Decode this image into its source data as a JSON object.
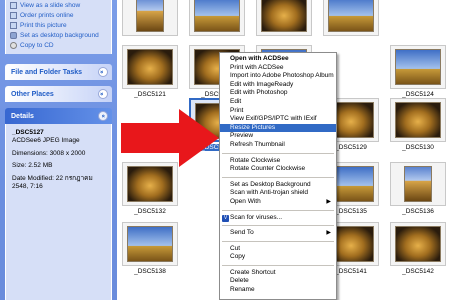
{
  "taskpane": {
    "picture_tasks": [
      {
        "label": "View as a slide show",
        "icon": "slideshow-icon"
      },
      {
        "label": "Order prints online",
        "icon": "prints-icon"
      },
      {
        "label": "Print this picture",
        "icon": "printer-icon"
      },
      {
        "label": "Set as desktop background",
        "icon": "desktop-icon"
      },
      {
        "label": "Copy to CD",
        "icon": "cd-icon"
      }
    ],
    "file_folder_tasks": "File and Folder Tasks",
    "other_places": "Other Places",
    "details": {
      "header": "Details",
      "filename": "_DSC5127",
      "type": "ACDSee6 JPEG Image",
      "dimensions": "Dimensions: 3008 x 2000",
      "size": "Size: 2.52 MB",
      "date_modified": "Date Modified: 22 กรกฎาคม 2548, 7:16"
    },
    "chevron": "«"
  },
  "thumbnails": [
    {
      "caption": "",
      "style": "portrait"
    },
    {
      "caption": "",
      "style": "sky"
    },
    {
      "caption": "",
      "style": "dark"
    },
    {
      "caption": "",
      "style": "sky"
    },
    {
      "caption": "_DSC5121",
      "style": "dark"
    },
    {
      "caption": "_DSC5122",
      "style": "dark"
    },
    {
      "caption": "_DSC5123",
      "style": "sky"
    },
    {
      "caption": "_DSC5124",
      "style": "sky"
    },
    {
      "caption": "_DSC5127",
      "style": "dark",
      "selected": true
    },
    {
      "caption": "_DSC5129",
      "style": "dark"
    },
    {
      "caption": "_DSC5130",
      "style": "dark"
    },
    {
      "caption": "_DSC5132",
      "style": "dark"
    },
    {
      "caption": "_DSC5135",
      "style": "sky"
    },
    {
      "caption": "_DSC5136",
      "style": "portrait"
    },
    {
      "caption": "_DSC5138",
      "style": "sky"
    },
    {
      "caption": "_DSC5141",
      "style": "dark"
    },
    {
      "caption": "_DSC5142",
      "style": "dark"
    }
  ],
  "context_menu": {
    "items": [
      {
        "label": "Open with ACDSee",
        "bold": true
      },
      {
        "label": "Print with ACDSee"
      },
      {
        "label": "Import into Adobe Photoshop Album"
      },
      {
        "label": "Edit with ImageReady"
      },
      {
        "label": "Edit with Photoshop"
      },
      {
        "label": "Edit"
      },
      {
        "label": "Print"
      },
      {
        "label": "View Exif/GPS/IPTC with IExif"
      },
      {
        "label": "Resize Pictures",
        "highlight": true
      },
      {
        "label": "Preview"
      },
      {
        "label": "Refresh Thumbnail"
      },
      {
        "sep": true
      },
      {
        "label": "Rotate Clockwise"
      },
      {
        "label": "Rotate Counter Clockwise"
      },
      {
        "sep": true
      },
      {
        "label": "Set as Desktop Background"
      },
      {
        "label": "Scan with Anti-trojan shield"
      },
      {
        "label": "Open With",
        "submenu": true
      },
      {
        "sep": true
      },
      {
        "label": "Scan for viruses...",
        "icon": true
      },
      {
        "sep": true
      },
      {
        "label": "Send To",
        "submenu": true
      },
      {
        "sep": true
      },
      {
        "label": "Cut"
      },
      {
        "label": "Copy"
      },
      {
        "sep": true
      },
      {
        "label": "Create Shortcut"
      },
      {
        "label": "Delete"
      },
      {
        "label": "Rename"
      }
    ],
    "submenu_arrow": "▶",
    "scan_icon_glyph": "V"
  },
  "colors": {
    "taskpane_bg": "#6b8fe0",
    "highlight": "#316ac5",
    "arrow": "#e8171b"
  }
}
